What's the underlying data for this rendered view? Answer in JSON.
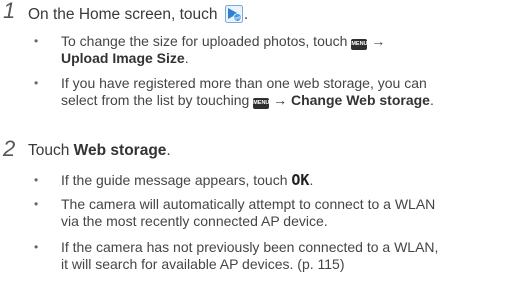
{
  "steps": [
    {
      "number": "1",
      "text_before": "On the Home screen, touch ",
      "text_after": ".",
      "icon": "share-upload-icon",
      "bullets": [
        {
          "line1": "To change the size for uploaded photos, touch",
          "menu_key": "MENU",
          "arrow": "→",
          "bold": "Upload Image Size",
          "end": "."
        },
        {
          "line1": "If you have registered more than one web storage, you can",
          "line2_pre": "select from the list by touching",
          "menu_key": "MENU",
          "arrow": "→",
          "bold": "Change Web storage",
          "end": "."
        }
      ]
    },
    {
      "number": "2",
      "text_before": "Touch ",
      "bold": "Web storage",
      "text_after": ".",
      "bullets": [
        {
          "pre": "If the guide message appears, touch",
          "ok": "OK",
          "end": "."
        },
        {
          "line1": "The camera will automatically attempt to connect to a WLAN",
          "line2": "via the most recently connected AP device."
        },
        {
          "line1": "If the camera has not previously been connected to a WLAN,",
          "line2": "it will search for available AP devices. (p. 115)"
        }
      ]
    }
  ],
  "bullet_char": "•",
  "colors": {
    "text": "#454545",
    "icon_blue": "#2f7fd6",
    "menu_key_bg": "#2f2f2f"
  }
}
